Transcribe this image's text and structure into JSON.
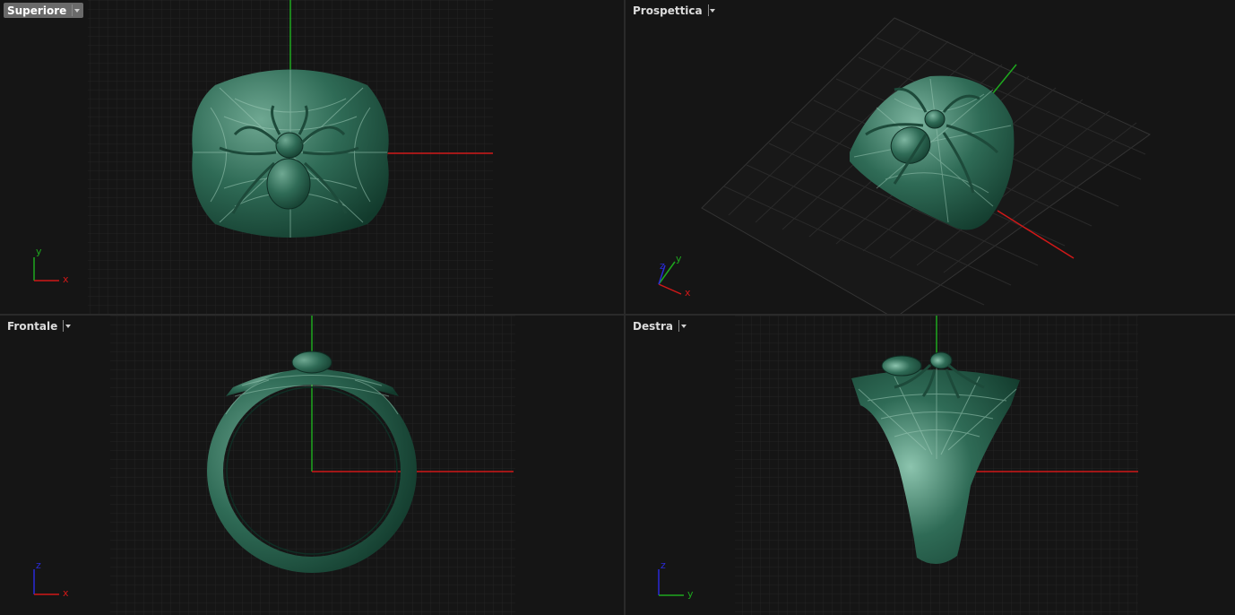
{
  "viewports": {
    "top": {
      "label": "Superiore",
      "active": true,
      "axis_h": "x",
      "axis_v": "y"
    },
    "persp": {
      "label": "Prospettica",
      "active": false,
      "axis_a": "x",
      "axis_b": "y",
      "axis_c": "z"
    },
    "front": {
      "label": "Frontale",
      "active": false,
      "axis_h": "x",
      "axis_v": "z"
    },
    "right": {
      "label": "Destra",
      "active": false,
      "axis_h": "y",
      "axis_v": "z"
    }
  },
  "colors": {
    "viewport_bg": "#151515",
    "grid": "#262626",
    "axis_x": "#d01818",
    "axis_y": "#1ea81e",
    "axis_z": "#2a2ad8",
    "model": "#2f6b56",
    "model_highlight": "#6fa892",
    "model_dark": "#123a2c"
  },
  "icons": {
    "dropdown": "chevron-down-icon"
  }
}
